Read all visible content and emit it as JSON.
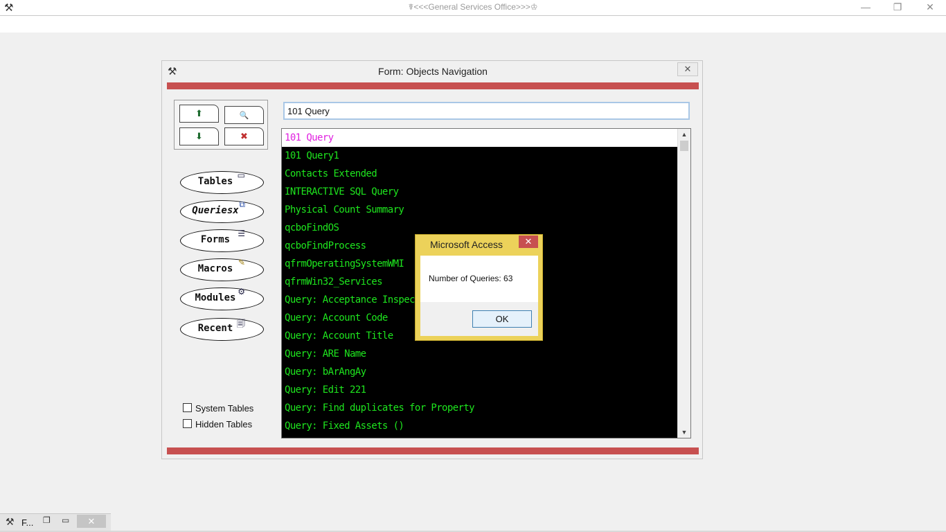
{
  "app": {
    "title": "☤<<<General Services Office>>>♔",
    "minimize_glyph": "—",
    "restore_glyph": "❐",
    "close_glyph": "✕"
  },
  "form": {
    "title": "Form: Objects Navigation",
    "close_glyph": "✕",
    "nav": {
      "prev_glyph": "⬆",
      "next_glyph": "⬇",
      "find_glyph": "🔍",
      "clear_filter_glyph": "✖"
    },
    "object_buttons": [
      {
        "label": "Tables",
        "icon": "table-icon"
      },
      {
        "label": "Queriesx",
        "icon": "query-icon"
      },
      {
        "label": "Forms",
        "icon": "form-icon"
      },
      {
        "label": "Macros",
        "icon": "macro-icon"
      },
      {
        "label": "Modules",
        "icon": "module-icon"
      },
      {
        "label": "Recent",
        "icon": "recent-icon"
      }
    ],
    "checkboxes": [
      {
        "label": "System Tables",
        "checked": false
      },
      {
        "label": "Hidden Tables",
        "checked": false
      }
    ],
    "search": {
      "value": "101 Query"
    },
    "list": {
      "selected_index": 0,
      "items": [
        "101 Query",
        "101 Query1",
        "Contacts Extended",
        "INTERACTIVE SQL Query",
        "Physical Count Summary",
        "qcboFindOS",
        "qcboFindProcess",
        "qfrmOperatingSystemWMI",
        "qfrmWin32_Services",
        "Query: Acceptance Inspection Re",
        "Query: Account Code",
        "Query: Account Title",
        "Query: ARE Name",
        "Query: bArAngAy",
        "Query: Edit 221",
        "Query: Find duplicates for Property",
        "Query: Fixed Assets ()"
      ]
    }
  },
  "dialog": {
    "title": "Microsoft Access",
    "close_glyph": "✕",
    "message": "Number of Queries: 63",
    "ok_label": "OK"
  },
  "taskbar": {
    "label": "F...",
    "restore_glyph": "❐",
    "minimize_glyph": "▭",
    "close_glyph": "✕"
  },
  "colors": {
    "accent_red": "#c75050",
    "list_text_green": "#1ee61e",
    "list_selected_magenta": "#e020e0",
    "dialog_frame_yellow": "#ecd25a"
  }
}
